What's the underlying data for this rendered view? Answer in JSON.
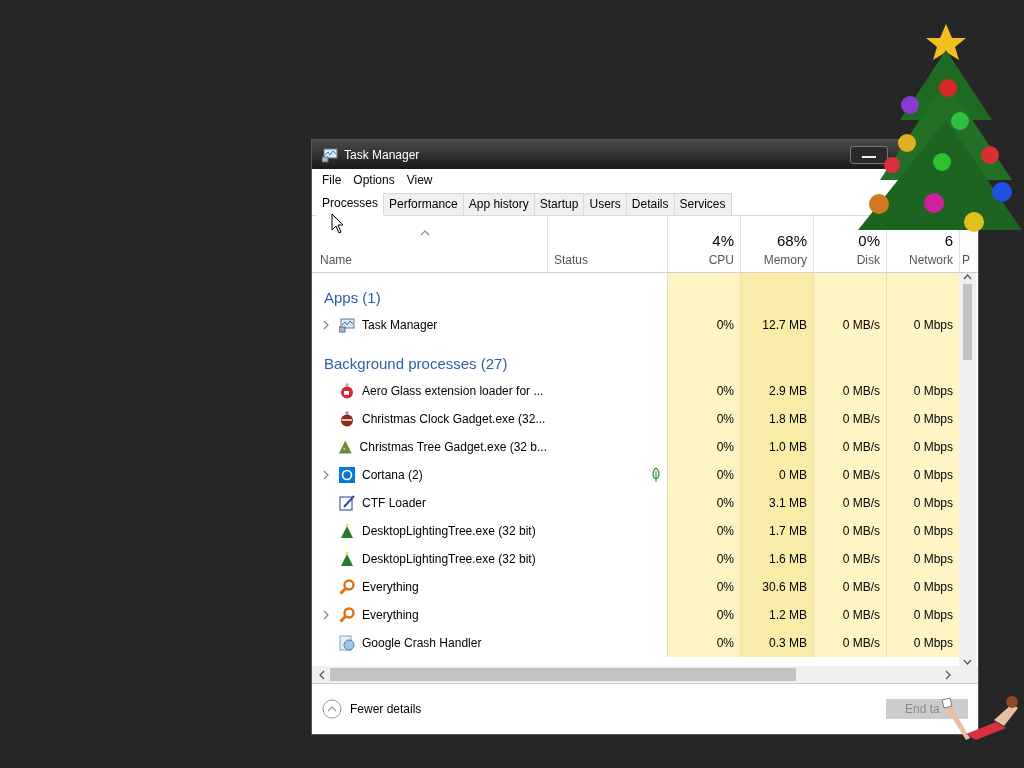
{
  "window": {
    "title": "Task Manager"
  },
  "menu": [
    "File",
    "Options",
    "View"
  ],
  "tabs": [
    {
      "label": "Processes",
      "selected": true
    },
    {
      "label": "Performance",
      "selected": false
    },
    {
      "label": "App history",
      "selected": false
    },
    {
      "label": "Startup",
      "selected": false
    },
    {
      "label": "Users",
      "selected": false
    },
    {
      "label": "Details",
      "selected": false
    },
    {
      "label": "Services",
      "selected": false
    }
  ],
  "columns": [
    {
      "label": "Name",
      "sorted": true
    },
    {
      "label": "Status"
    },
    {
      "label": "CPU",
      "total": "4%"
    },
    {
      "label": "Memory",
      "total": "68%"
    },
    {
      "label": "Disk",
      "total": "0%"
    },
    {
      "label": "Network",
      "total": "6"
    },
    {
      "label": "P"
    }
  ],
  "groups": [
    {
      "title": "Apps (1)",
      "rows": [
        {
          "name": "Task Manager",
          "expandable": true,
          "efficiency": false,
          "cpu": "0%",
          "memory": "12.7 MB",
          "disk": "0 MB/s",
          "network": "0 Mbps"
        }
      ]
    },
    {
      "title": "Background processes (27)",
      "rows": [
        {
          "name": "Aero Glass extension loader for ...",
          "expandable": false,
          "efficiency": false,
          "cpu": "0%",
          "memory": "2.9 MB",
          "disk": "0 MB/s",
          "network": "0 Mbps"
        },
        {
          "name": "Christmas Clock Gadget.exe (32...",
          "expandable": false,
          "efficiency": false,
          "cpu": "0%",
          "memory": "1.8 MB",
          "disk": "0 MB/s",
          "network": "0 Mbps"
        },
        {
          "name": "Christmas Tree Gadget.exe (32 b...",
          "expandable": false,
          "efficiency": false,
          "cpu": "0%",
          "memory": "1.0 MB",
          "disk": "0 MB/s",
          "network": "0 Mbps"
        },
        {
          "name": "Cortana (2)",
          "expandable": true,
          "efficiency": true,
          "cpu": "0%",
          "memory": "0 MB",
          "disk": "0 MB/s",
          "network": "0 Mbps"
        },
        {
          "name": "CTF Loader",
          "expandable": false,
          "efficiency": false,
          "cpu": "0%",
          "memory": "3.1 MB",
          "disk": "0 MB/s",
          "network": "0 Mbps"
        },
        {
          "name": "DesktopLightingTree.exe (32 bit)",
          "expandable": false,
          "efficiency": false,
          "cpu": "0%",
          "memory": "1.7 MB",
          "disk": "0 MB/s",
          "network": "0 Mbps"
        },
        {
          "name": "DesktopLightingTree.exe (32 bit)",
          "expandable": false,
          "efficiency": false,
          "cpu": "0%",
          "memory": "1.6 MB",
          "disk": "0 MB/s",
          "network": "0 Mbps"
        },
        {
          "name": "Everything",
          "expandable": false,
          "efficiency": false,
          "cpu": "0%",
          "memory": "30.6 MB",
          "disk": "0 MB/s",
          "network": "0 Mbps"
        },
        {
          "name": "Everything",
          "expandable": true,
          "efficiency": false,
          "cpu": "0%",
          "memory": "1.2 MB",
          "disk": "0 MB/s",
          "network": "0 Mbps"
        },
        {
          "name": "Google Crash Handler",
          "expandable": false,
          "efficiency": false,
          "cpu": "0%",
          "memory": "0.3 MB",
          "disk": "0 MB/s",
          "network": "0 Mbps"
        }
      ]
    }
  ],
  "footer": {
    "details_label": "Fewer details",
    "end_task": {
      "label": "End ta",
      "disabled": true
    }
  }
}
